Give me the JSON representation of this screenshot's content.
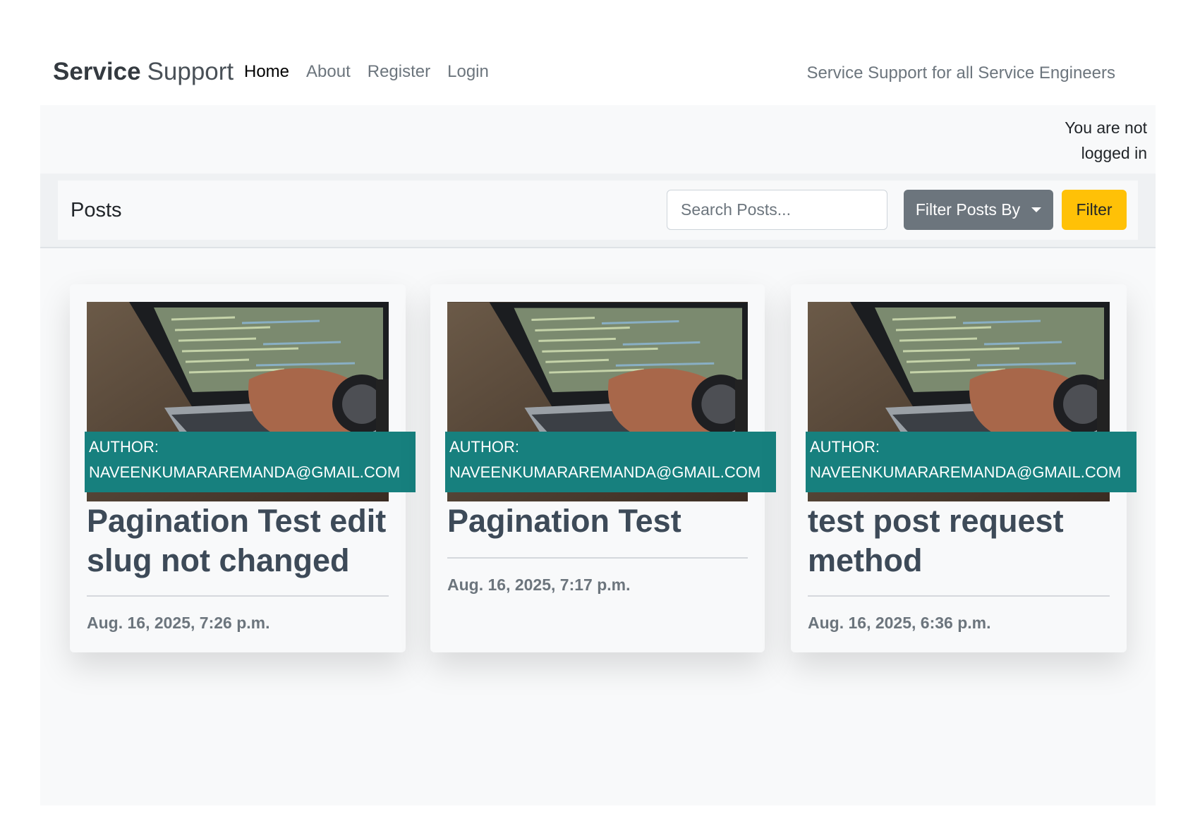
{
  "navbar": {
    "brand_bold": "Service",
    "brand_light": "Support",
    "links": [
      {
        "label": "Home",
        "active": true
      },
      {
        "label": "About",
        "active": false
      },
      {
        "label": "Register",
        "active": false
      },
      {
        "label": "Login",
        "active": false
      }
    ],
    "tagline": "Service Support for all Service Engineers"
  },
  "status": {
    "text": "You are not logged in"
  },
  "toolbar": {
    "title": "Posts",
    "search_placeholder": "Search Posts...",
    "filter_by_label": "Filter Posts By",
    "filter_label": "Filter"
  },
  "posts": [
    {
      "author_label": "AUTHOR:",
      "author": "NAVEENKUMARAREMANDA@GMAIL.COM",
      "title": "Pagination Test edit slug not changed",
      "date": "Aug. 16, 2025, 7:26 p.m."
    },
    {
      "author_label": "AUTHOR:",
      "author": "NAVEENKUMARAREMANDA@GMAIL.COM",
      "title": "Pagination Test",
      "date": "Aug. 16, 2025, 7:17 p.m."
    },
    {
      "author_label": "AUTHOR:",
      "author": "NAVEENKUMARAREMANDA@GMAIL.COM",
      "title": "test post request method",
      "date": "Aug. 16, 2025, 6:36 p.m."
    }
  ],
  "colors": {
    "author_band": "#17807e",
    "filter_button": "#ffc107",
    "filter_by_button": "#6c757d"
  }
}
